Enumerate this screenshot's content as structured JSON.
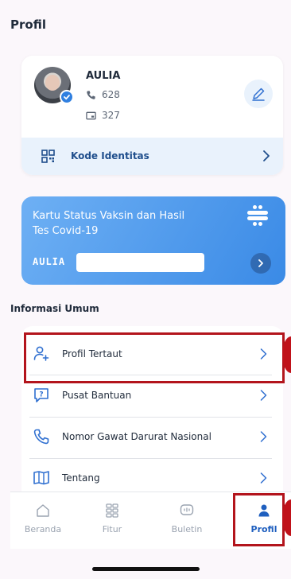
{
  "page": {
    "title": "Profil"
  },
  "profile": {
    "name": "AULIA",
    "phone": "628",
    "nik": "327",
    "kode_identitas_label": "Kode Identitas"
  },
  "vaksin": {
    "title": "Kartu Status Vaksin dan Hasil Tes Covid-19",
    "name": "AULIA"
  },
  "info": {
    "section_title": "Informasi Umum",
    "items": [
      {
        "label": "Profil Tertaut",
        "icon": "person-add-icon"
      },
      {
        "label": "Pusat Bantuan",
        "icon": "help-bubble-icon"
      },
      {
        "label": "Nomor Gawat Darurat Nasional",
        "icon": "phone-icon"
      },
      {
        "label": "Tentang",
        "icon": "book-icon"
      }
    ]
  },
  "nav": {
    "items": [
      {
        "label": "Beranda",
        "icon": "home-icon"
      },
      {
        "label": "Fitur",
        "icon": "grid-icon"
      },
      {
        "label": "Buletin",
        "icon": "chat-icon"
      },
      {
        "label": "Profil",
        "icon": "person-icon",
        "active": true
      }
    ]
  },
  "colors": {
    "accent": "#1f5fbf",
    "card_blue": "#3a8ae6",
    "highlight": "#b3141c"
  }
}
